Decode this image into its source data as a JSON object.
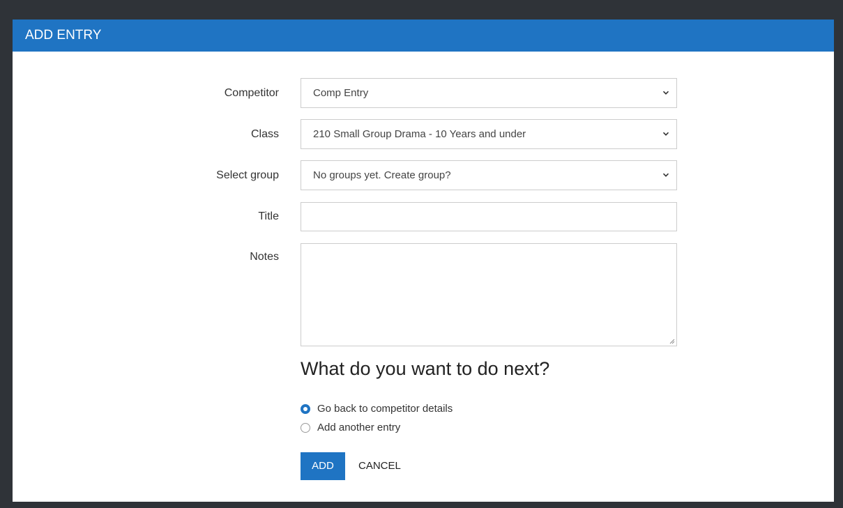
{
  "modal": {
    "title": "ADD ENTRY",
    "accent_color": "#1f74c3"
  },
  "form": {
    "competitor": {
      "label": "Competitor",
      "value": "Comp Entry"
    },
    "class": {
      "label": "Class",
      "value": "210 Small Group Drama - 10 Years and under"
    },
    "group": {
      "label": "Select group",
      "value": "No groups yet. Create group?"
    },
    "title": {
      "label": "Title",
      "value": ""
    },
    "notes": {
      "label": "Notes",
      "value": ""
    }
  },
  "next": {
    "question": "What do you want to do next?",
    "options": [
      {
        "label": "Go back to competitor details",
        "checked": true
      },
      {
        "label": "Add another entry",
        "checked": false
      }
    ]
  },
  "actions": {
    "add_label": "ADD",
    "cancel_label": "CANCEL"
  }
}
